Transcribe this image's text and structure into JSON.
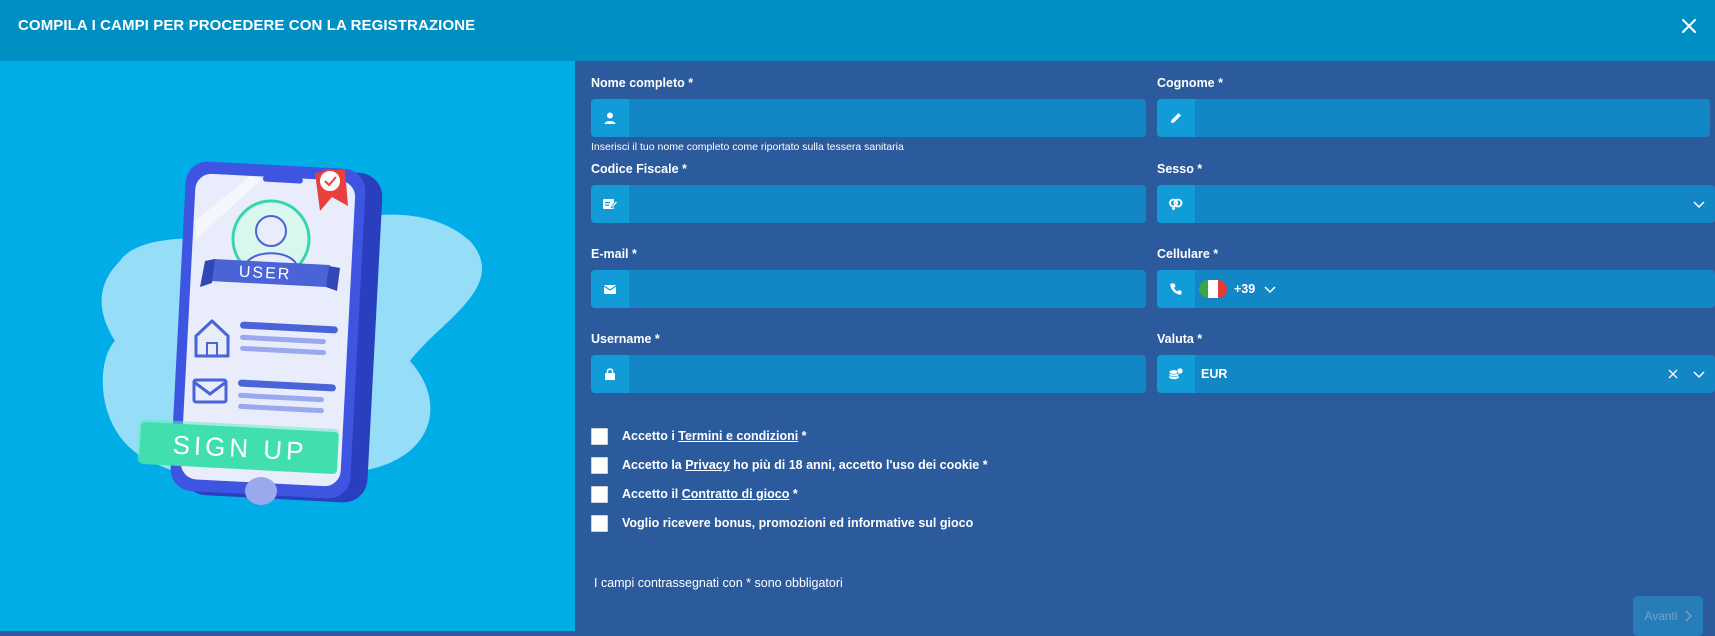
{
  "header": {
    "title": "COMPILA I CAMPI PER PROCEDERE CON LA REGISTRAZIONE"
  },
  "illustration": {
    "user_label": "USER",
    "signup_label": "SIGN UP"
  },
  "form": {
    "nome": {
      "label": "Nome completo *",
      "hint": "Inserisci il tuo nome completo come riportato sulla tessera sanitaria",
      "value": "",
      "icon": "user-icon"
    },
    "cognome": {
      "label": "Cognome *",
      "value": "",
      "icon": "pencil-icon"
    },
    "codice_fiscale": {
      "label": "Codice Fiscale *",
      "value": "",
      "icon": "id-card-icon"
    },
    "sesso": {
      "label": "Sesso *",
      "value": "",
      "icon": "gender-icon"
    },
    "email": {
      "label": "E-mail *",
      "value": "",
      "icon": "envelope-icon"
    },
    "cellulare": {
      "label": "Cellulare *",
      "prefix": "+39",
      "value": "",
      "icon": "phone-icon",
      "flag": "italy-flag-icon"
    },
    "username": {
      "label": "Username *",
      "value": "",
      "icon": "lock-icon"
    },
    "valuta": {
      "label": "Valuta *",
      "value": "EUR",
      "icon": "coins-icon"
    }
  },
  "checkboxes": [
    {
      "pre": "Accetto i ",
      "link": "Termini e condizioni",
      "post": " *",
      "checked": false
    },
    {
      "pre": "Accetto la ",
      "link": "Privacy",
      "post": " ho più di 18 anni, accetto l'uso dei cookie *",
      "checked": false
    },
    {
      "pre": "Accetto il ",
      "link": "Contratto di gioco",
      "post": " *",
      "checked": false
    },
    {
      "pre": "Voglio ricevere bonus, promozioni ed informative sul gioco",
      "link": "",
      "post": "",
      "checked": false
    }
  ],
  "required_note": "I campi contrassegnati con * sono obbligatori",
  "next_button": {
    "label": "Avanti"
  },
  "colors": {
    "header": "#008fc2",
    "left_panel": "#01ade7",
    "right_panel": "#2b5a9d",
    "field": "#1386c6",
    "field_icon": "#119cd8"
  }
}
